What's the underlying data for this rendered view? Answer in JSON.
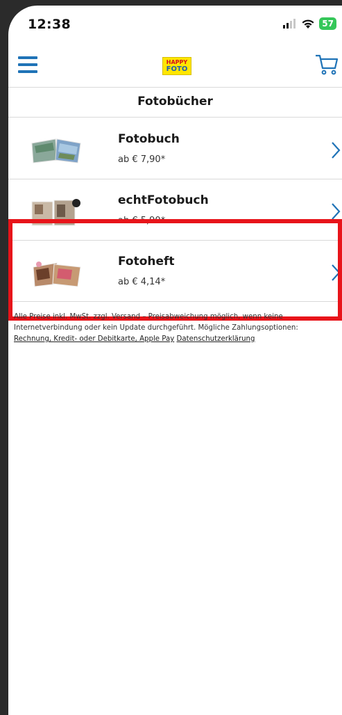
{
  "status_bar": {
    "time": "12:38",
    "battery": "57"
  },
  "navbar": {
    "logo_line1": "HAPPY",
    "logo_line2": "FOTO",
    "menu_icon": "hamburger-menu-icon",
    "cart_icon": "shopping-cart-icon",
    "brand_color": "#1f73b7"
  },
  "page": {
    "title": "Fotobücher"
  },
  "products": [
    {
      "name": "Fotobuch",
      "price": "ab € 7,90*"
    },
    {
      "name": "echtFotobuch",
      "price": "ab € 5,90*"
    },
    {
      "name": "Fotoheft",
      "price": "ab € 4,14*"
    }
  ],
  "footer": {
    "disclaimer_text": "Alle Preise inkl. MwSt. zzgl. Versand – Preisabweichung möglich, wenn keine Internetverbindung oder kein Update durchgeführt. Mögliche Zahlungsoptionen: ",
    "payment_link": "Rechnung, Kredit- oder Debitkarte, Apple Pay",
    "privacy_link": "Datenschutzerklärung"
  },
  "highlight_color": "#e8141a"
}
